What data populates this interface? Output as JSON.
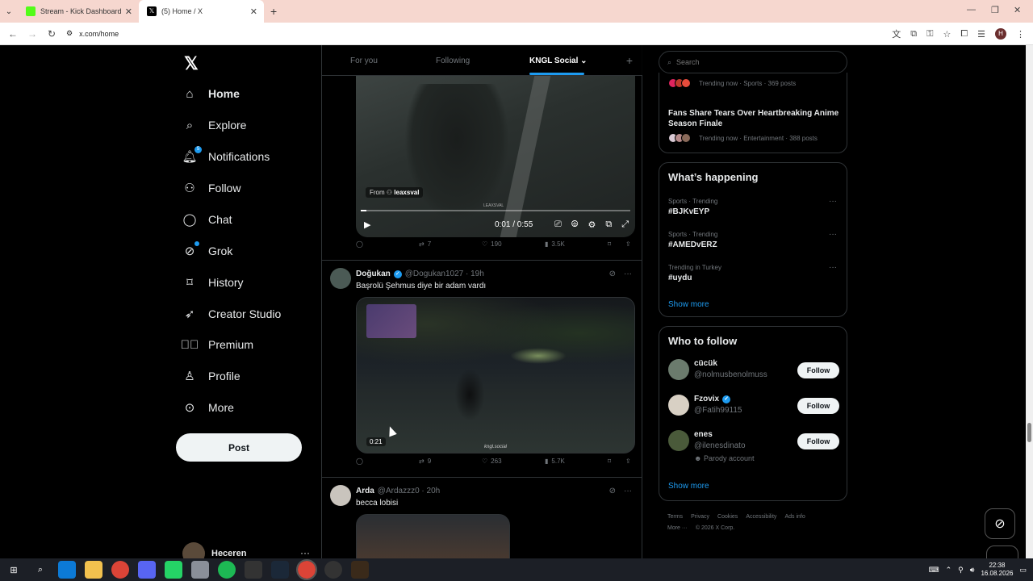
{
  "browser": {
    "tabs": [
      {
        "title": "Stream - Kick Dashboard",
        "favicon_color": "#53fc18",
        "active": false
      },
      {
        "title": "(5) Home / X",
        "favicon_color": "#000000",
        "active": true
      }
    ],
    "url": "x.com/home",
    "profile_initial": "H"
  },
  "nav": {
    "items": [
      {
        "label": "Home",
        "icon": "home-icon"
      },
      {
        "label": "Explore",
        "icon": "search-icon"
      },
      {
        "label": "Notifications",
        "icon": "bell-icon",
        "badge": "5"
      },
      {
        "label": "Follow",
        "icon": "person-plus-icon"
      },
      {
        "label": "Chat",
        "icon": "chat-icon"
      },
      {
        "label": "Grok",
        "icon": "grok-icon"
      },
      {
        "label": "History",
        "icon": "bookmark-icon"
      },
      {
        "label": "Creator Studio",
        "icon": "rocket-icon"
      },
      {
        "label": "Premium",
        "icon": "verified-icon"
      },
      {
        "label": "Profile",
        "icon": "person-icon"
      },
      {
        "label": "More",
        "icon": "more-circle-icon"
      }
    ],
    "post_label": "Post",
    "account_name": "Heceren"
  },
  "timeline": {
    "tabs": [
      "For you",
      "Following",
      "KNGL Social"
    ],
    "post1": {
      "from_prefix": "From",
      "from_user": "leaxsval",
      "watermark": "LEAXSVAL",
      "time": "0:01 / 0:55",
      "replies": "",
      "reposts": "7",
      "likes": "190",
      "views": "3.5K",
      "progress": 0.02
    },
    "post2": {
      "name": "Doğukan",
      "handle": "@Dogukan1027 · 19h",
      "text": "Başrolü Şehmus diye bir adam vardı",
      "video_time": "0:21",
      "watermark": "kngl.social",
      "reposts": "9",
      "likes": "263",
      "views": "5.7K"
    },
    "post3": {
      "name": "Arda",
      "handle": "@Ardazzz0 · 20h",
      "text": "becca lobisi"
    }
  },
  "sidebar": {
    "search_placeholder": "Search",
    "trend_top": {
      "meta": "Trending now · Sports · 369 posts"
    },
    "trend_story": {
      "title": "Fans Share Tears Over Heartbreaking Anime Season Finale",
      "meta": "Trending now · Entertainment · 388 posts"
    },
    "happening": {
      "title": "What’s happening",
      "items": [
        {
          "meta": "Sports · Trending",
          "tag": "#BJKvEYP"
        },
        {
          "meta": "Sports · Trending",
          "tag": "#AMEDvERZ"
        },
        {
          "meta": "Trending in Turkey",
          "tag": "#uydu"
        }
      ],
      "show_more": "Show more"
    },
    "who_to_follow": {
      "title": "Who to follow",
      "users": [
        {
          "name": "cücük",
          "handle": "@nolmusbenolmuss",
          "verified": false,
          "extra": ""
        },
        {
          "name": "Fzovix",
          "handle": "@Fatih99115",
          "verified": true,
          "extra": ""
        },
        {
          "name": "enes",
          "handle": "@ilenesdinato",
          "verified": false,
          "extra": "Parody account"
        }
      ],
      "follow_label": "Follow",
      "show_more": "Show more"
    },
    "footer": {
      "links": [
        "Terms",
        "Privacy",
        "Cookies",
        "Accessibility",
        "Ads info",
        "More ···"
      ],
      "copyright": "© 2026 X Corp."
    }
  },
  "taskbar": {
    "time": "22:38",
    "date": "16.08.2026"
  }
}
